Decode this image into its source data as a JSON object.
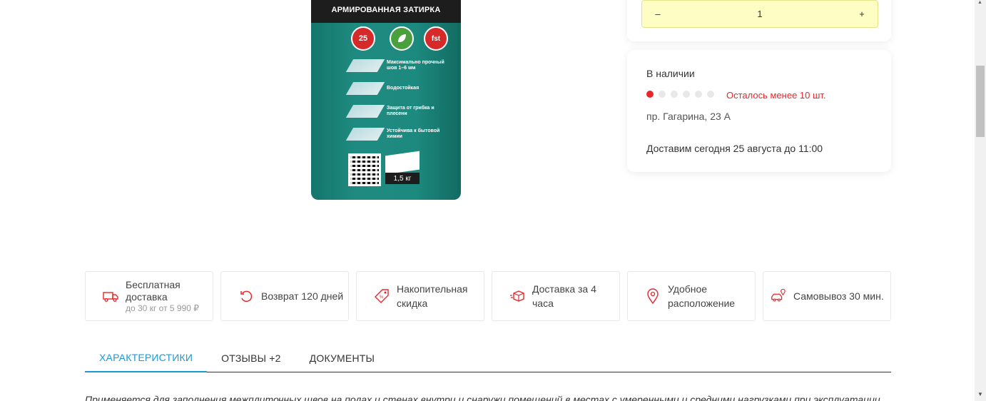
{
  "product": {
    "bag_title": "АРМИРОВАННАЯ ЗАТИРКА",
    "badge_years": "25",
    "badge_fst": "fst",
    "features": [
      "Максимально прочный шов 1–6 мм",
      "Водостойкая",
      "Защита от грибка и плесени",
      "Устойчива к бытовой химии"
    ],
    "weight": "1,5 кг"
  },
  "quantity": {
    "minus": "–",
    "value": "1",
    "plus": "+"
  },
  "stock": {
    "status": "В наличии",
    "level": 0.17,
    "remaining": "Осталось менее 10 шт.",
    "address": "пр. Гагарина, 23 А",
    "delivery": "Доставим сегодня 25 августа до 11:00"
  },
  "features_row": [
    {
      "title": "Бесплатная доставка",
      "sub": "до 30 кг от 5 990 ₽",
      "icon": "truck-free-icon"
    },
    {
      "title": "Возврат 120 дней",
      "icon": "return-icon"
    },
    {
      "title": "Накопительная скидка",
      "icon": "discount-tag-icon"
    },
    {
      "title": "Доставка за 4 часа",
      "icon": "fast-box-icon"
    },
    {
      "title": "Удобное расположение",
      "icon": "location-pin-icon"
    },
    {
      "title": "Самовывоз 30 мин.",
      "icon": "car-pin-icon"
    }
  ],
  "tabs": [
    {
      "label": "Характеристики",
      "active": true
    },
    {
      "label": "Отзывы +2"
    },
    {
      "label": "Документы"
    }
  ],
  "description": "Применяется для заполнения межплиточных швов на полах и стенах внутри и снаружи помещений в местах с умеренными и средними нагрузками при эксплуатации",
  "colors": {
    "accent": "#1b9ad6",
    "warning": "#e8272b",
    "qty_bg": "#fdfdc4"
  }
}
